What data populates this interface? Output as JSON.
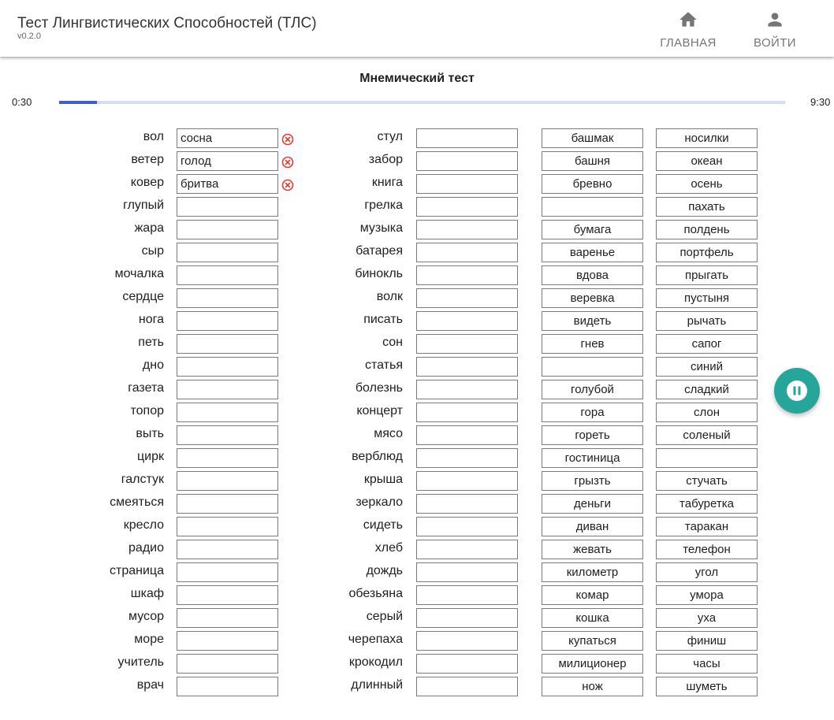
{
  "app": {
    "title": "Тест Лингвистических Способностей (ТЛС)",
    "version": "v0.2.0"
  },
  "nav": {
    "home_label": "ГЛАВНАЯ",
    "home_icon": "home-icon",
    "login_label": "ВОЙТИ",
    "login_icon": "person-icon"
  },
  "test": {
    "title": "Мнемический тест",
    "elapsed": "0:30",
    "total": "9:30",
    "progress_fraction": 0.0526
  },
  "colors": {
    "progress_fill": "#3b5fd6",
    "progress_track": "#d3ddf7",
    "error": "#e53935",
    "fab": "#26a69a"
  },
  "column1": {
    "cues": [
      "вол",
      "ветер",
      "ковер",
      "глупый",
      "жара",
      "сыр",
      "мочалка",
      "сердце",
      "нога",
      "петь",
      "дно",
      "газета",
      "топор",
      "выть",
      "цирк",
      "галстук",
      "смеяться",
      "кресло",
      "радио",
      "страница",
      "шкаф",
      "мусор",
      "море",
      "учитель",
      "врач"
    ],
    "answers": [
      "сосна",
      "голод",
      "бритва",
      "",
      "",
      "",
      "",
      "",
      "",
      "",
      "",
      "",
      "",
      "",
      "",
      "",
      "",
      "",
      "",
      "",
      "",
      "",
      "",
      "",
      ""
    ],
    "errors": [
      true,
      true,
      true,
      false,
      false,
      false,
      false,
      false,
      false,
      false,
      false,
      false,
      false,
      false,
      false,
      false,
      false,
      false,
      false,
      false,
      false,
      false,
      false,
      false,
      false
    ]
  },
  "column2": {
    "cues": [
      "стул",
      "забор",
      "книга",
      "грелка",
      "музыка",
      "батарея",
      "бинокль",
      "волк",
      "писать",
      "сон",
      "статья",
      "болезнь",
      "концерт",
      "мясо",
      "верблюд",
      "крыша",
      "зеркало",
      "сидеть",
      "хлеб",
      "дождь",
      "обезьяна",
      "серый",
      "черепаха",
      "крокодил",
      "длинный"
    ],
    "answers": [
      "",
      "",
      "",
      "",
      "",
      "",
      "",
      "",
      "",
      "",
      "",
      "",
      "",
      "",
      "",
      "",
      "",
      "",
      "",
      "",
      "",
      "",
      "",
      "",
      ""
    ]
  },
  "word_bank_1": [
    "башмак",
    "башня",
    "бревно",
    "",
    "бумага",
    "варенье",
    "вдова",
    "веревка",
    "видеть",
    "гнев",
    "",
    "голубой",
    "гора",
    "гореть",
    "гостиница",
    "грызть",
    "деньги",
    "диван",
    "жевать",
    "километр",
    "комар",
    "кошка",
    "купаться",
    "милиционер",
    "нож"
  ],
  "word_bank_2": [
    "носилки",
    "океан",
    "осень",
    "пахать",
    "полдень",
    "портфель",
    "прыгать",
    "пустыня",
    "рычать",
    "сапог",
    "синий",
    "сладкий",
    "слон",
    "соленый",
    "",
    "стучать",
    "табуретка",
    "таракан",
    "телефон",
    "угол",
    "умора",
    "уха",
    "финиш",
    "часы",
    "шуметь"
  ],
  "fab": {
    "icon": "pause-icon"
  }
}
